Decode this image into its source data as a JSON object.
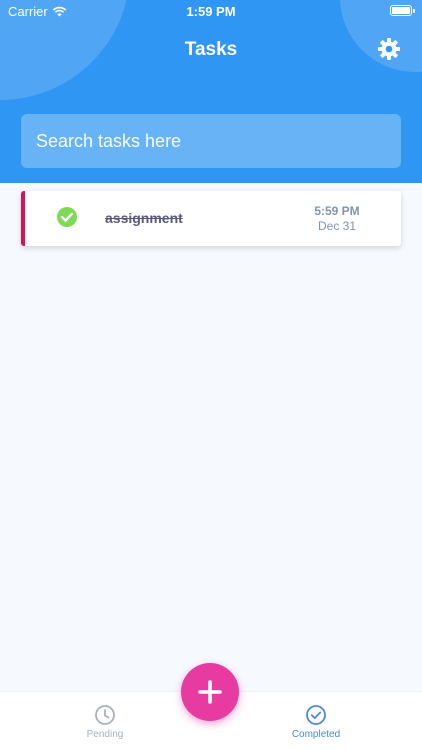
{
  "status_bar": {
    "carrier": "Carrier",
    "time": "1:59 PM"
  },
  "header": {
    "title": "Tasks",
    "settings_icon": "gear-icon"
  },
  "search": {
    "placeholder": "Search tasks here"
  },
  "tasks": [
    {
      "title": "assignment",
      "time": "5:59 PM",
      "date": "Dec 31",
      "completed": true
    }
  ],
  "tabs": [
    {
      "label": "Pending",
      "icon": "clock-icon",
      "active": false
    },
    {
      "label": "Completed",
      "icon": "check-circle-icon",
      "active": true
    }
  ],
  "colors": {
    "header_bg": "#2f96f3",
    "task_accent": "#d8115f",
    "check_green": "#7ed957",
    "fab": "#e73ba2",
    "tab_active": "#4d89d6",
    "tab_inactive": "#a8b1bc"
  }
}
